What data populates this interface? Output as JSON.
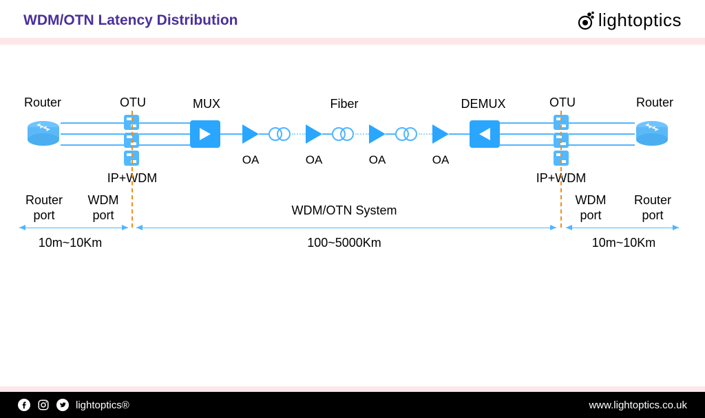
{
  "header": {
    "title": "WDM/OTN Latency Distribution",
    "brand": "lightoptics"
  },
  "labels": {
    "router_l": "Router",
    "router_r": "Router",
    "otu_l": "OTU",
    "otu_r": "OTU",
    "mux": "MUX",
    "demux": "DEMUX",
    "fiber": "Fiber",
    "oa1": "OA",
    "oa2": "OA",
    "oa3": "OA",
    "oa4": "OA",
    "ipwdm_l": "IP+WDM",
    "ipwdm_r": "IP+WDM",
    "router_port_l": "Router\nport",
    "router_port_r": "Router\nport",
    "wdm_port_l": "WDM\nport",
    "wdm_port_r": "WDM\nport",
    "system": "WDM/OTN System",
    "dist_side_l": "10m~10Km",
    "dist_side_r": "10m~10Km",
    "dist_mid": "100~5000Km"
  },
  "footer": {
    "brand": "lightoptics®",
    "url": "www.lightoptics.co.uk"
  }
}
